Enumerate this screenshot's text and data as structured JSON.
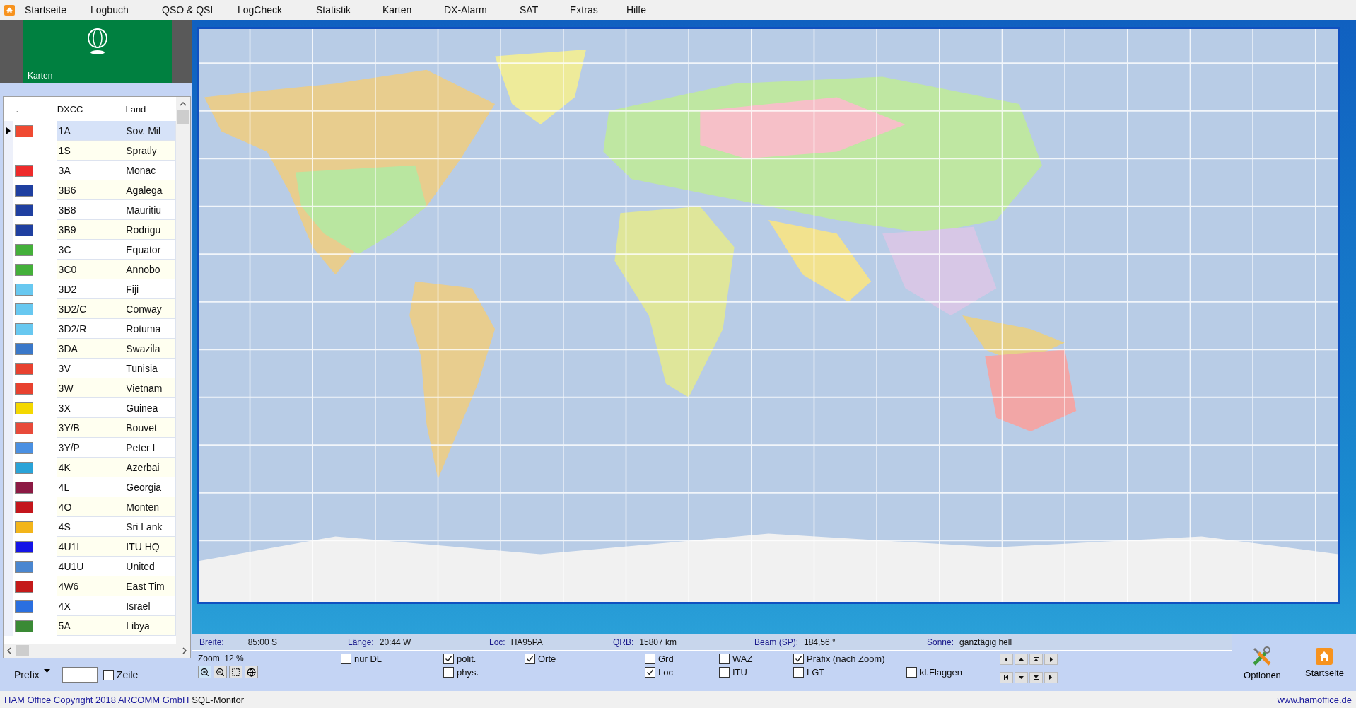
{
  "menu": {
    "items": [
      "Startseite",
      "Logbuch",
      "QSO & QSL",
      "LogCheck",
      "Statistik",
      "Karten",
      "DX-Alarm",
      "SAT",
      "Extras",
      "Hilfe"
    ]
  },
  "tile": {
    "label": "Karten"
  },
  "dxcc_table": {
    "columns": [
      ".",
      "DXCC",
      "Land"
    ],
    "rows": [
      {
        "prefix": "1A",
        "land": "Sov. Mil",
        "color": "#f04a32",
        "selected": true
      },
      {
        "prefix": "1S",
        "land": "Spratly",
        "selected": false
      },
      {
        "prefix": "3A",
        "land": "Monac",
        "color": "#ee2b2b",
        "selected": false
      },
      {
        "prefix": "3B6",
        "land": "Agalega",
        "color": "#1f3fa0",
        "selected": false
      },
      {
        "prefix": "3B8",
        "land": "Mauritiu",
        "color": "#1f3fa0",
        "selected": false
      },
      {
        "prefix": "3B9",
        "land": "Rodrigu",
        "color": "#1f3fa0",
        "selected": false
      },
      {
        "prefix": "3C",
        "land": "Equator",
        "color": "#44b03a",
        "selected": false
      },
      {
        "prefix": "3C0",
        "land": "Annobo",
        "color": "#44b03a",
        "selected": false
      },
      {
        "prefix": "3D2",
        "land": "Fiji",
        "color": "#68c8f0",
        "selected": false
      },
      {
        "prefix": "3D2/C",
        "land": "Conway",
        "color": "#68c8f0",
        "selected": false
      },
      {
        "prefix": "3D2/R",
        "land": "Rotuma",
        "color": "#68c8f0",
        "selected": false
      },
      {
        "prefix": "3DA",
        "land": "Swazila",
        "color": "#3a78c9",
        "selected": false
      },
      {
        "prefix": "3V",
        "land": "Tunisia",
        "color": "#e8412f",
        "selected": false
      },
      {
        "prefix": "3W",
        "land": "Vietnam",
        "color": "#e8412f",
        "selected": false
      },
      {
        "prefix": "3X",
        "land": "Guinea",
        "color": "#f4d800",
        "selected": false
      },
      {
        "prefix": "3Y/B",
        "land": "Bouvet",
        "color": "#e84a3a",
        "selected": false
      },
      {
        "prefix": "3Y/P",
        "land": "Peter I",
        "color": "#4a90e2",
        "selected": false
      },
      {
        "prefix": "4K",
        "land": "Azerbai",
        "color": "#2aa3d8",
        "selected": false
      },
      {
        "prefix": "4L",
        "land": "Georgia",
        "color": "#8c1a44",
        "selected": false
      },
      {
        "prefix": "4O",
        "land": "Monten",
        "color": "#c4161c",
        "selected": false
      },
      {
        "prefix": "4S",
        "land": "Sri Lank",
        "color": "#f3b51a",
        "selected": false
      },
      {
        "prefix": "4U1I",
        "land": "ITU HQ",
        "color": "#1414e6",
        "selected": false
      },
      {
        "prefix": "4U1U",
        "land": "United",
        "color": "#4a86d0",
        "selected": false
      },
      {
        "prefix": "4W6",
        "land": "East Tim",
        "color": "#c41a1a",
        "selected": false
      },
      {
        "prefix": "4X",
        "land": "Israel",
        "color": "#2a6fe0",
        "selected": false
      },
      {
        "prefix": "5A",
        "land": "Libya",
        "color": "#3a8a35",
        "selected": false
      }
    ]
  },
  "prefix_filter": {
    "label": "Prefix",
    "row_option": {
      "label": "Zeile",
      "checked": false
    }
  },
  "position": [
    {
      "label": "Breite:",
      "value": "85:00 S"
    },
    {
      "label": "Länge:",
      "value": "20:44 W"
    },
    {
      "label": "Loc:",
      "value": "HA95PA"
    },
    {
      "label": "QRB:",
      "value": "15807 km"
    },
    {
      "label": "Beam (SP):",
      "value": "184,56 °"
    },
    {
      "label": "Sonne:",
      "value": "ganztägig hell"
    }
  ],
  "zoom": {
    "label": "Zoom",
    "value": "12 %"
  },
  "layers": [
    {
      "columns": [
        [
          {
            "label": "nur DL",
            "checked": false
          }
        ],
        [
          {
            "label": "polit.",
            "checked": true
          },
          {
            "label": "phys.",
            "checked": false
          }
        ],
        [
          {
            "label": "Orte",
            "checked": true
          }
        ]
      ]
    },
    {
      "columns": [
        [
          {
            "label": "Grd",
            "checked": false
          },
          {
            "label": "Loc",
            "checked": true
          }
        ],
        [
          {
            "label": "WAZ",
            "checked": false
          },
          {
            "label": "ITU",
            "checked": false
          }
        ],
        [
          {
            "label": "Präfix (nach Zoom)",
            "checked": true
          },
          {
            "label": "LGT",
            "checked": false
          }
        ],
        [
          {
            "label": "kl.Flaggen",
            "checked": false
          }
        ]
      ]
    }
  ],
  "actions": [
    {
      "label": "Optionen",
      "kind": "options"
    },
    {
      "label": "Startseite",
      "kind": "home"
    }
  ],
  "status_bar": {
    "copyright": "HAM Office Copyright 2018 ARCOMM GmbH",
    "monitor": "SQL-Monitor",
    "website": "www.hamoffice.de"
  }
}
